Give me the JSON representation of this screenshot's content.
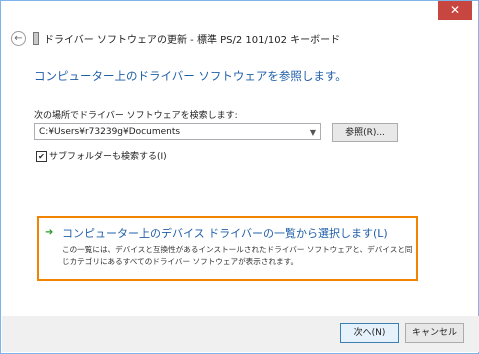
{
  "window": {
    "title": "ドライバー ソフトウェアの更新 - 標準 PS/2 101/102 キーボード",
    "close_glyph": "✕"
  },
  "heading": "コンピューター上のドライバー ソフトウェアを参照します。",
  "search": {
    "label": "次の場所でドライバー ソフトウェアを検索します:",
    "path_value": "C:¥Users¥r73239g¥Documents",
    "browse_label": "参照(R)..."
  },
  "subfolders": {
    "label": "サブフォルダーも検索する(I)",
    "checked": true
  },
  "option": {
    "title": "コンピューター上のデバイス ドライバーの一覧から選択します(L)",
    "description": "この一覧には、デバイスと互換性があるインストールされたドライバー ソフトウェアと、デバイスと同じカテゴリにあるすべてのドライバー ソフトウェアが表示されます。"
  },
  "footer": {
    "next_label": "次へ(N)",
    "cancel_label": "キャンセル"
  },
  "icons": {
    "back": "back-arrow-icon",
    "device": "device-icon",
    "option_arrow": "green-arrow-icon",
    "close": "close-icon",
    "dropdown": "chevron-down-icon",
    "check": "checkmark-icon"
  },
  "colors": {
    "accent_link": "#1f5fa8",
    "highlight_border": "#f08300",
    "close_button": "#c7463f"
  }
}
